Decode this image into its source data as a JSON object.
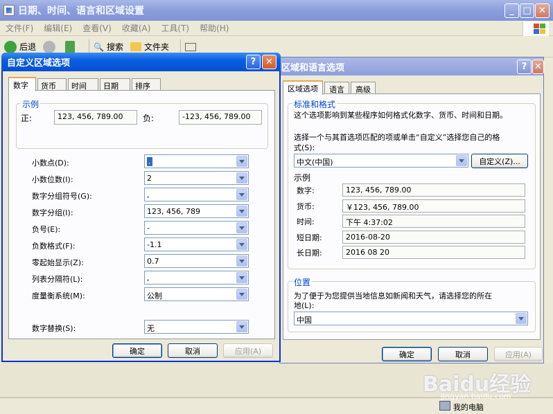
{
  "main_window": {
    "title": "日期、时间、语言和区域设置",
    "menu": [
      "文件(F)",
      "编辑(E)",
      "查看(V)",
      "收藏(A)",
      "工具(T)",
      "帮助(H)"
    ],
    "toolbar": {
      "back": "后退",
      "search": "搜索",
      "folders": "文件夹"
    },
    "status": "我的电脑"
  },
  "region_dialog": {
    "title": "区域和语言选项",
    "tabs": [
      "区域选项",
      "语言",
      "高级"
    ],
    "standards_group": "标准和格式",
    "standards_desc": "这个选项影响到某些程序如何格式化数字、货币、时间和日期。",
    "select_desc_1": "选择一个与其首选项匹配的项或单击“自定义”选择您自己的格",
    "select_desc_2": "式(S):",
    "locale": "中文(中国)",
    "customize_button": "自定义(Z)...",
    "samples_label": "示例",
    "samples": [
      {
        "label": "数字:",
        "value": "123, 456, 789.00"
      },
      {
        "label": "货币:",
        "value": "￥123, 456, 789.00"
      },
      {
        "label": "时间:",
        "value": "下午 4:37:02"
      },
      {
        "label": "短日期:",
        "value": "2016-08-20"
      },
      {
        "label": "长日期:",
        "value": "2016 08 20"
      }
    ],
    "location_group": "位置",
    "location_desc_1": "为了便于为您提供当地信息如新闻和天气，请选择您的所在",
    "location_desc_2": "地(L):",
    "location": "中国",
    "buttons": {
      "ok": "确定",
      "cancel": "取消",
      "apply": "应用(A)"
    }
  },
  "customize_dialog": {
    "title": "自定义区域选项",
    "tabs": [
      "数字",
      "货币",
      "时间",
      "日期",
      "排序"
    ],
    "example_group": "示例",
    "positive_label": "正:",
    "positive_value": "123, 456, 789.00",
    "negative_label": "负:",
    "negative_value": "-123, 456, 789.00",
    "fields": [
      {
        "label": "小数点(D):",
        "value": "."
      },
      {
        "label": "小数位数(I):",
        "value": "2"
      },
      {
        "label": "数字分组符号(G):",
        "value": ","
      },
      {
        "label": "数字分组(I):",
        "value": "123, 456, 789"
      },
      {
        "label": "负号(E):",
        "value": "-"
      },
      {
        "label": "负数格式(F):",
        "value": "-1.1"
      },
      {
        "label": "零起始显示(Z):",
        "value": "0.7"
      },
      {
        "label": "列表分隔符(L):",
        "value": ","
      },
      {
        "label": "度量衡系统(M):",
        "value": "公制"
      }
    ],
    "digit_sub_label": "数字替换(S):",
    "digit_sub_value": "无",
    "buttons": {
      "ok": "确定",
      "cancel": "取消",
      "apply": "应用(A)"
    }
  },
  "watermark": {
    "brand": "Baidu经验",
    "url": "jingyan.baidu.com"
  }
}
